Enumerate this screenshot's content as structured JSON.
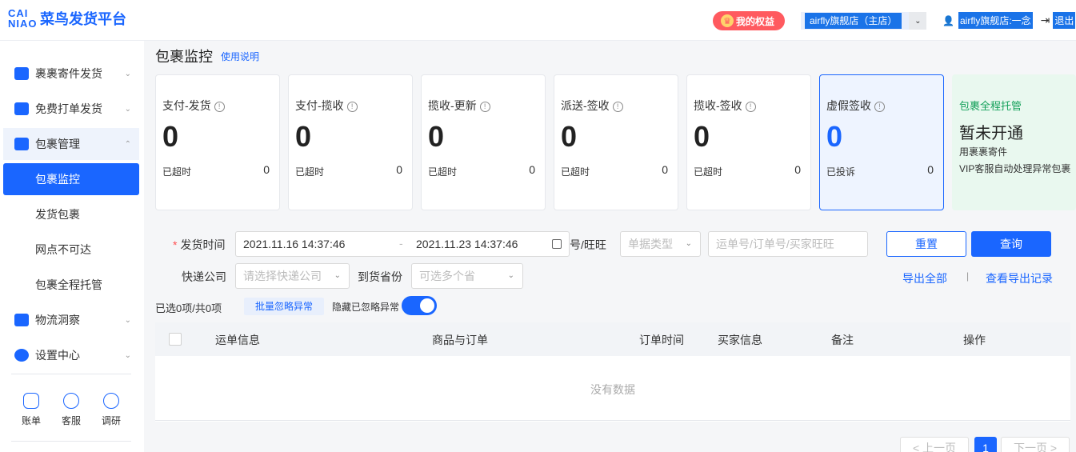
{
  "header": {
    "logo_mark": "CAI NIAO",
    "logo_text": "菜鸟发货平台",
    "rights_label": "我的权益",
    "shop_name": "airfly旗舰店（主店）",
    "user_name": "airfly旗舰店:一念",
    "logout_label": "退出"
  },
  "sidebar": {
    "items": [
      {
        "label": "裹裹寄件发货"
      },
      {
        "label": "免费打单发货"
      },
      {
        "label": "包裹管理"
      },
      {
        "label": "物流洞察"
      },
      {
        "label": "设置中心"
      }
    ],
    "sub_items": [
      {
        "label": "包裹监控"
      },
      {
        "label": "发货包裹"
      },
      {
        "label": "网点不可达"
      },
      {
        "label": "包裹全程托管"
      }
    ],
    "tools": [
      {
        "label": "账单",
        "icon": "bill-icon"
      },
      {
        "label": "客服",
        "icon": "service-icon"
      },
      {
        "label": "调研",
        "icon": "survey-icon"
      }
    ]
  },
  "main": {
    "title": "包裹监控",
    "help_link": "使用说明"
  },
  "cards": [
    {
      "title": "支付-发货",
      "value": "0",
      "sub_label": "已超时",
      "sub_value": "0"
    },
    {
      "title": "支付-揽收",
      "value": "0",
      "sub_label": "已超时",
      "sub_value": "0"
    },
    {
      "title": "揽收-更新",
      "value": "0",
      "sub_label": "已超时",
      "sub_value": "0"
    },
    {
      "title": "派送-签收",
      "value": "0",
      "sub_label": "已超时",
      "sub_value": "0"
    },
    {
      "title": "揽收-签收",
      "value": "0",
      "sub_label": "已超时",
      "sub_value": "0"
    },
    {
      "title": "虚假签收",
      "value": "0",
      "sub_label": "已投诉",
      "sub_value": "0"
    }
  ],
  "promo": {
    "title": "包裹全程托管",
    "status": "暂未开通",
    "desc1": "用裹裹寄件",
    "desc2": "VIP客服自动处理异常包裹"
  },
  "filters": {
    "ship_time_label": "发货时间",
    "date_start": "2021.11.16 14:37:46",
    "date_sep": "-",
    "date_end": "2021.11.23 14:37:46",
    "doc_label_partial": "号/旺旺",
    "doc_type_placeholder": "单据类型",
    "doc_input_placeholder": "运单号/订单号/买家旺旺",
    "courier_label": "快递公司",
    "courier_placeholder": "请选择快递公司",
    "province_label": "到货省份",
    "province_placeholder": "可选多个省",
    "reset_label": "重置",
    "query_label": "查询",
    "export_all": "导出全部",
    "export_sep": "|",
    "export_records": "查看导出记录"
  },
  "table_bar": {
    "selected_count": "已选0项/共0项",
    "batch_ignore": "批量忽略异常",
    "hide_ignored": "隐藏已忽略异常",
    "hide_ignored_on": true
  },
  "table": {
    "columns": [
      "运单信息",
      "商品与订单",
      "订单时间",
      "买家信息",
      "备注",
      "操作"
    ],
    "empty_text": "没有数据"
  },
  "pagination": {
    "prev": "< 上一页",
    "current": "1",
    "next": "下一页 >"
  },
  "colors": {
    "primary": "#1a66ff",
    "promo_green": "#14a05a",
    "rights_red": "#ff5a5f"
  }
}
